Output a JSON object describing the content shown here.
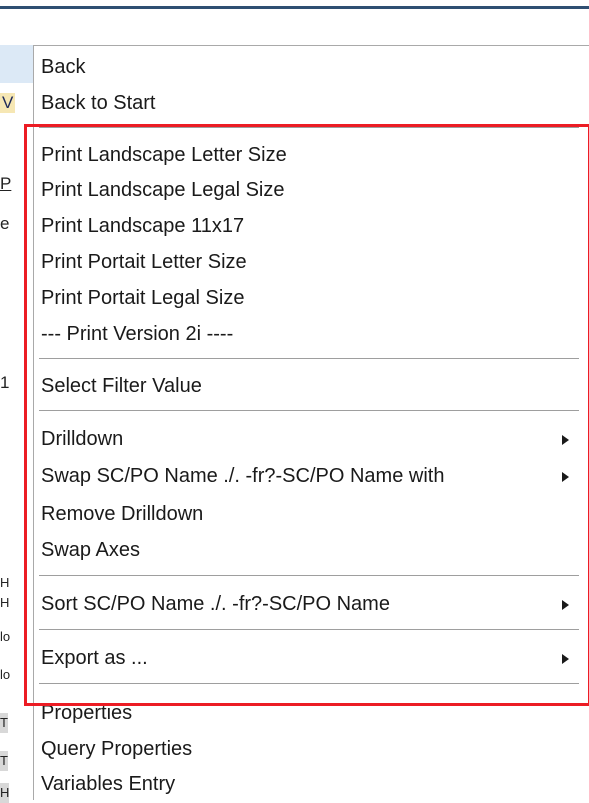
{
  "background_fragments": [
    "V",
    "P",
    "e",
    "1",
    "H",
    "H",
    "lo",
    "lo",
    "T",
    "T",
    "H"
  ],
  "menu": {
    "items": [
      {
        "label": "Back",
        "submenu": false
      },
      {
        "label": "Back to Start",
        "submenu": false
      },
      {
        "label": "Print Landscape Letter Size",
        "submenu": false
      },
      {
        "label": "Print Landscape Legal Size",
        "submenu": false
      },
      {
        "label": "Print Landscape 11x17",
        "submenu": false
      },
      {
        "label": "Print Portait Letter Size",
        "submenu": false
      },
      {
        "label": "Print Portait Legal Size",
        "submenu": false
      },
      {
        "label": "--- Print Version 2i ----",
        "submenu": false
      },
      {
        "label": "Select Filter Value",
        "submenu": false
      },
      {
        "label": "Drilldown",
        "submenu": true
      },
      {
        "label": "Swap SC/PO Name ./. -fr?-SC/PO Name with",
        "submenu": true
      },
      {
        "label": "Remove Drilldown",
        "submenu": false
      },
      {
        "label": "Swap Axes",
        "submenu": false
      },
      {
        "label": "Sort SC/PO Name ./. -fr?-SC/PO Name",
        "submenu": true
      },
      {
        "label": "Export as ...",
        "submenu": true
      },
      {
        "label": "Properties",
        "submenu": false
      },
      {
        "label": "Query Properties",
        "submenu": false
      },
      {
        "label": "Variables Entry",
        "submenu": false
      }
    ]
  },
  "colors": {
    "highlight": "#ec1c24",
    "topbar": "#2f4f72",
    "separator": "#9e9e9e"
  }
}
